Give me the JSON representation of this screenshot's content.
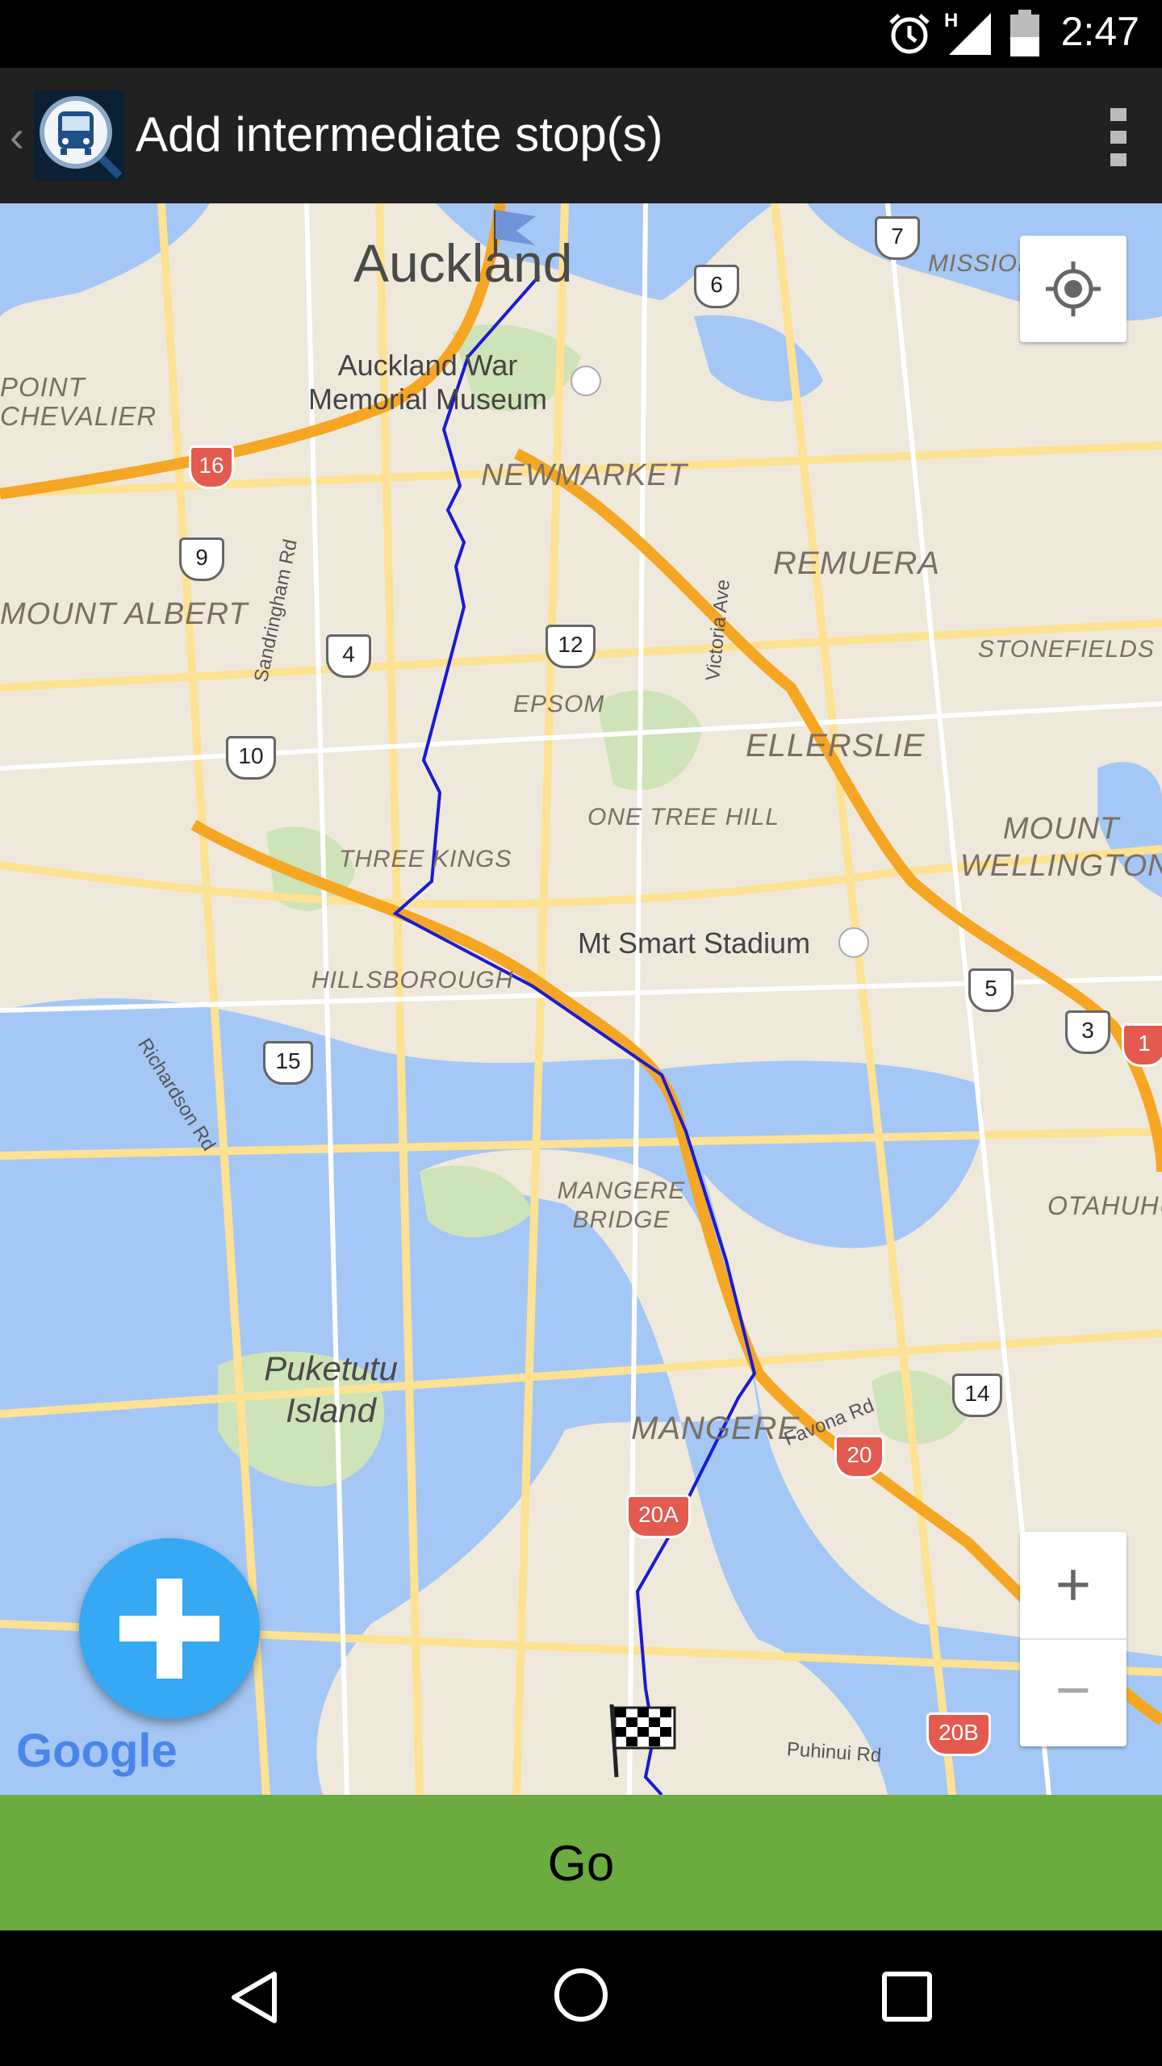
{
  "status_bar": {
    "time": "2:47",
    "network_label": "H"
  },
  "action_bar": {
    "title": "Add intermediate stop(s)"
  },
  "map": {
    "city_label": "Auckland",
    "poi_labels": [
      "Auckland War Memorial Museum",
      "Mt Smart Stadium"
    ],
    "suburb_labels": [
      "POINT CHEVALIER",
      "MOUNT ALBERT",
      "NEWMARKET",
      "REMUERA",
      "EPSOM",
      "STONEFIELDS",
      "ELLERSLIE",
      "ONE TREE HILL",
      "MOUNT WELLINGTON",
      "THREE KINGS",
      "HILLSBOROUGH",
      "MANGERE BRIDGE",
      "MANGERE",
      "OTAHUHU",
      "MISSION BAY"
    ],
    "island_label": "Puketutu Island",
    "road_labels": [
      "Victoria Ave",
      "Sandringham Rd",
      "Richardson Rd",
      "Favona Rd",
      "Puhinui Rd"
    ],
    "route_shields": [
      "7",
      "6",
      "16",
      "9",
      "4",
      "12",
      "10",
      "5",
      "3",
      "1",
      "15",
      "14",
      "20",
      "20A",
      "20B"
    ],
    "attribution": "Google",
    "zoom_in_label": "+",
    "zoom_out_label": "−"
  },
  "go_button": {
    "label": "Go"
  },
  "colors": {
    "go_bar": "#6cab3f",
    "fab": "#36a8f4",
    "route_line": "#1a1ad6",
    "motorway": "#f5a623"
  }
}
